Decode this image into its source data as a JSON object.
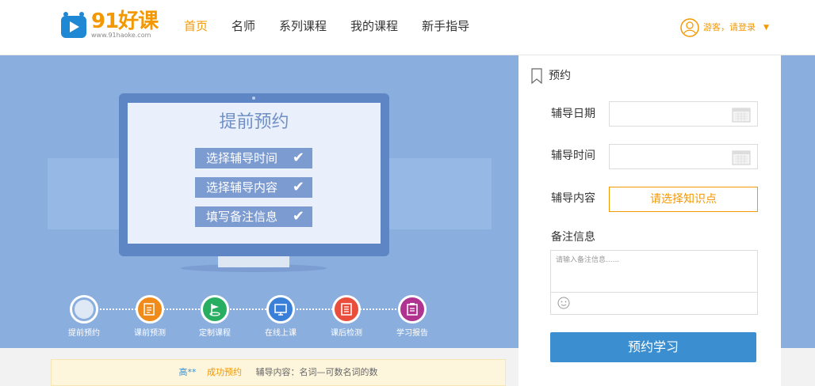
{
  "header": {
    "logo_text": "91好课",
    "logo_url": "www.91haoke.com",
    "nav": [
      "首页",
      "名师",
      "系列课程",
      "我的课程",
      "新手指导"
    ],
    "active_nav": "首页",
    "user_text": "游客，请登录",
    "user_caret": "▼"
  },
  "banner": {
    "screen_title": "提前预约",
    "checklist": [
      "选择辅导时间",
      "选择辅导内容",
      "填写备注信息"
    ],
    "check_mark": "✔",
    "steps": [
      {
        "label": "提前预约",
        "color": "#ffffff",
        "icon": "circle-icon"
      },
      {
        "label": "课前预测",
        "color": "#f08a18",
        "icon": "edit-icon"
      },
      {
        "label": "定制课程",
        "color": "#27ae60",
        "icon": "flag-icon"
      },
      {
        "label": "在线上课",
        "color": "#3a7fd8",
        "icon": "monitor-icon"
      },
      {
        "label": "课后检测",
        "color": "#e94e3c",
        "icon": "list-icon"
      },
      {
        "label": "学习报告",
        "color": "#b0348f",
        "icon": "report-icon"
      }
    ]
  },
  "panel": {
    "title": "预约",
    "date_label": "辅导日期",
    "time_label": "辅导时间",
    "content_label": "辅导内容",
    "content_button": "请选择知识点",
    "remark_label": "备注信息",
    "remark_placeholder": "请输入备注信息......",
    "submit_label": "预约学习"
  },
  "notice": {
    "name": "高**",
    "status": "成功预约",
    "detail": "辅导内容：名词—可数名词的数"
  },
  "colors": {
    "accent": "#f39800",
    "primary": "#3b8fd0",
    "banner_bg": "#8aaede"
  }
}
